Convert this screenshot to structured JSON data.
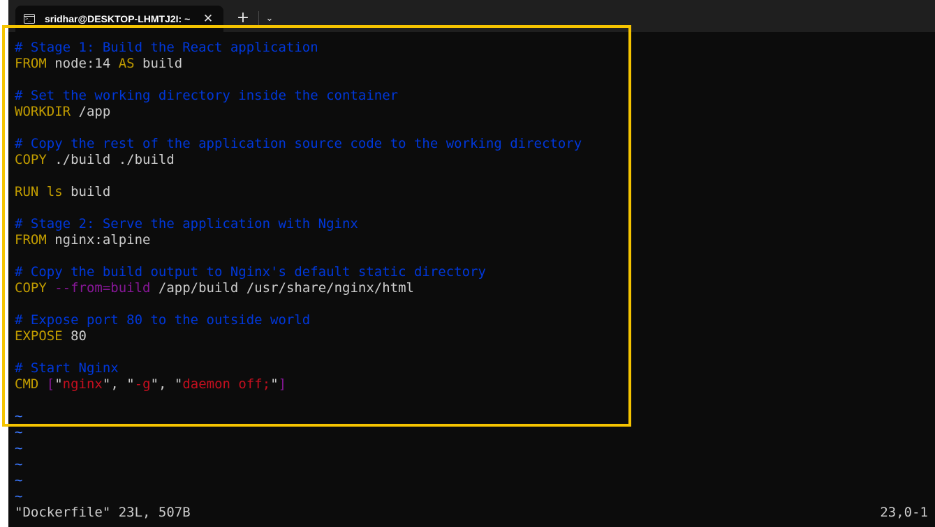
{
  "tab": {
    "title": "sridhar@DESKTOP-LHMTJ2I: ~",
    "close": "✕",
    "new_tab": "+",
    "dropdown": "⌄"
  },
  "colors": {
    "comment": "#0037da",
    "keyword": "#c19c00",
    "text": "#cccccc",
    "string": "#c50f1f",
    "bracket": "#881798",
    "tilde": "#3b78ff",
    "highlight_border": "#f5c400"
  },
  "editor": {
    "lines": {
      "l1": "# Stage 1: Build the React application",
      "l2_kw": "FROM",
      "l2_a": " node:14 ",
      "l2_kw2": "AS",
      "l2_b": " build",
      "l4": "# Set the working directory inside the container",
      "l5_kw": "WORKDIR",
      "l5_a": " /app",
      "l7": "# Copy the rest of the application source code to the working directory",
      "l8_kw": "COPY",
      "l8_a": " ./build ./build",
      "l10_kw": "RUN",
      "l10_kw2": " ls",
      "l10_a": " build",
      "l12": "# Stage 2: Serve the application with Nginx",
      "l13_kw": "FROM",
      "l13_a": " nginx:alpine",
      "l15": "# Copy the build output to Nginx's default static directory",
      "l16_kw": "COPY",
      "l16_opt": " --from=build",
      "l16_a": " /app/build /usr/share/nginx/html",
      "l18": "# Expose port 80 to the outside world",
      "l19_kw": "EXPOSE",
      "l19_a": " 80",
      "l21": "# Start Nginx",
      "l22_kw": "CMD",
      "l22_b1": " [",
      "l22_q1": "\"",
      "l22_s1": "nginx",
      "l22_q2": "\"",
      "l22_sep1": ", ",
      "l22_q3": "\"",
      "l22_s2": "-g",
      "l22_q4": "\"",
      "l22_sep2": ", ",
      "l22_q5": "\"",
      "l22_s3": "daemon off;",
      "l22_q6": "\"",
      "l22_b2": "]"
    },
    "tilde": "~"
  },
  "status": {
    "file_info": "\"Dockerfile\" 23L, 507B",
    "position": "23,0-1"
  }
}
